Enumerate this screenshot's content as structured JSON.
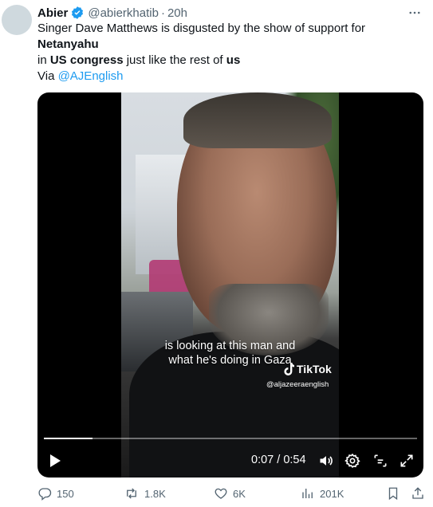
{
  "tweet": {
    "display_name": "Abier",
    "handle": "@abierkhatib",
    "separator": "·",
    "time": "20h",
    "text_parts": [
      "Singer Dave Matthews is disgusted by the show of support for ",
      "Netanyahu",
      "in ",
      "US congress",
      " just like the rest of ",
      "us"
    ],
    "via_label": "Via ",
    "via_mention": "@AJEnglish"
  },
  "video": {
    "caption_line1": "is looking at this man and",
    "caption_line2": "what he's doing in Gaza",
    "watermark_brand": "TikTok",
    "watermark_handle": "@aljazeeraenglish",
    "current_time": "0:07",
    "time_separator": " / ",
    "duration": "0:54",
    "progress_fraction": 0.13
  },
  "actions": {
    "replies": "150",
    "reposts": "1.8K",
    "likes": "6K",
    "views": "201K"
  },
  "colors": {
    "accent": "#1d9bf0",
    "text": "#0f1419",
    "muted": "#536471"
  },
  "icons": [
    "verified-badge-icon",
    "more-icon",
    "play-icon",
    "volume-icon",
    "settings-icon",
    "captions-icon",
    "fullscreen-icon",
    "reply-icon",
    "repost-icon",
    "like-icon",
    "views-icon",
    "bookmark-icon",
    "share-icon"
  ]
}
